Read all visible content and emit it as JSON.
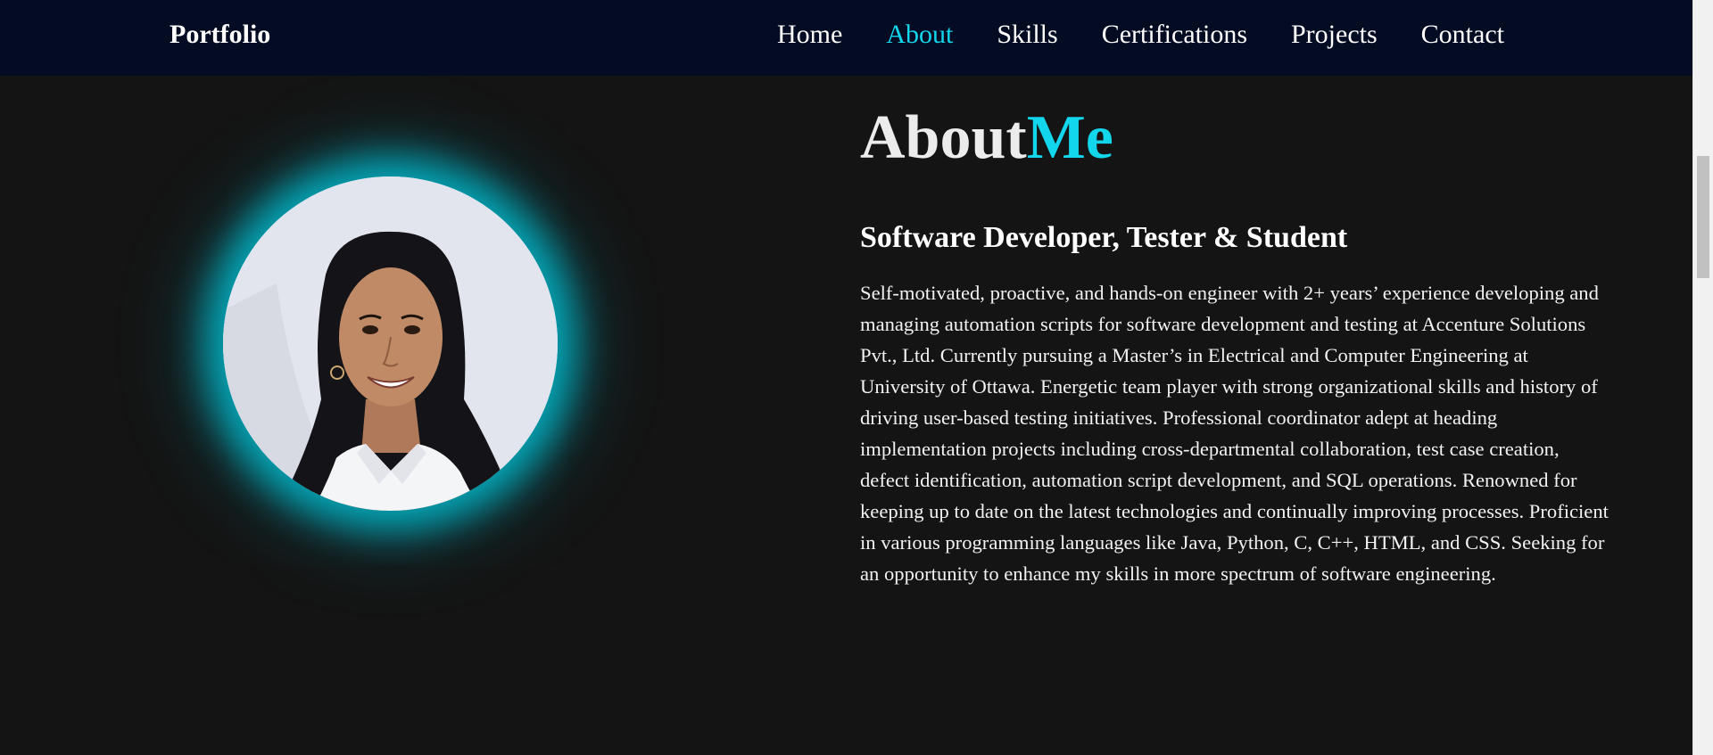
{
  "navbar": {
    "brand": "Portfolio",
    "links": [
      {
        "label": "Home",
        "active": false
      },
      {
        "label": "About",
        "active": true
      },
      {
        "label": "Skills",
        "active": false
      },
      {
        "label": "Certifications",
        "active": false
      },
      {
        "label": "Projects",
        "active": false
      },
      {
        "label": "Contact",
        "active": false
      }
    ]
  },
  "about": {
    "heading_main": "About",
    "heading_accent": "Me",
    "subtitle": "Software Developer, Tester & Student",
    "bio": "Self-motivated, proactive, and hands-on engineer with 2+ years’ experience developing and managing automation scripts for software development and testing at Accenture Solutions Pvt., Ltd. Currently pursuing a Master’s in Electrical and Computer Engineering at University of Ottawa. Energetic team player with strong organizational skills and history of driving user-based testing initiatives. Professional coordinator adept at heading implementation projects including cross-departmental collaboration, test case creation, defect identification, automation script development, and SQL operations. Renowned for keeping up to date on the latest technologies and continually improving processes. Proficient in various programming languages like Java, Python, C, C++, HTML, and CSS. Seeking for an opportunity to enhance my skills in more spectrum of software engineering."
  },
  "colors": {
    "accent": "#12d6ec",
    "navbar_bg": "#040c23",
    "page_bg": "#141414"
  }
}
